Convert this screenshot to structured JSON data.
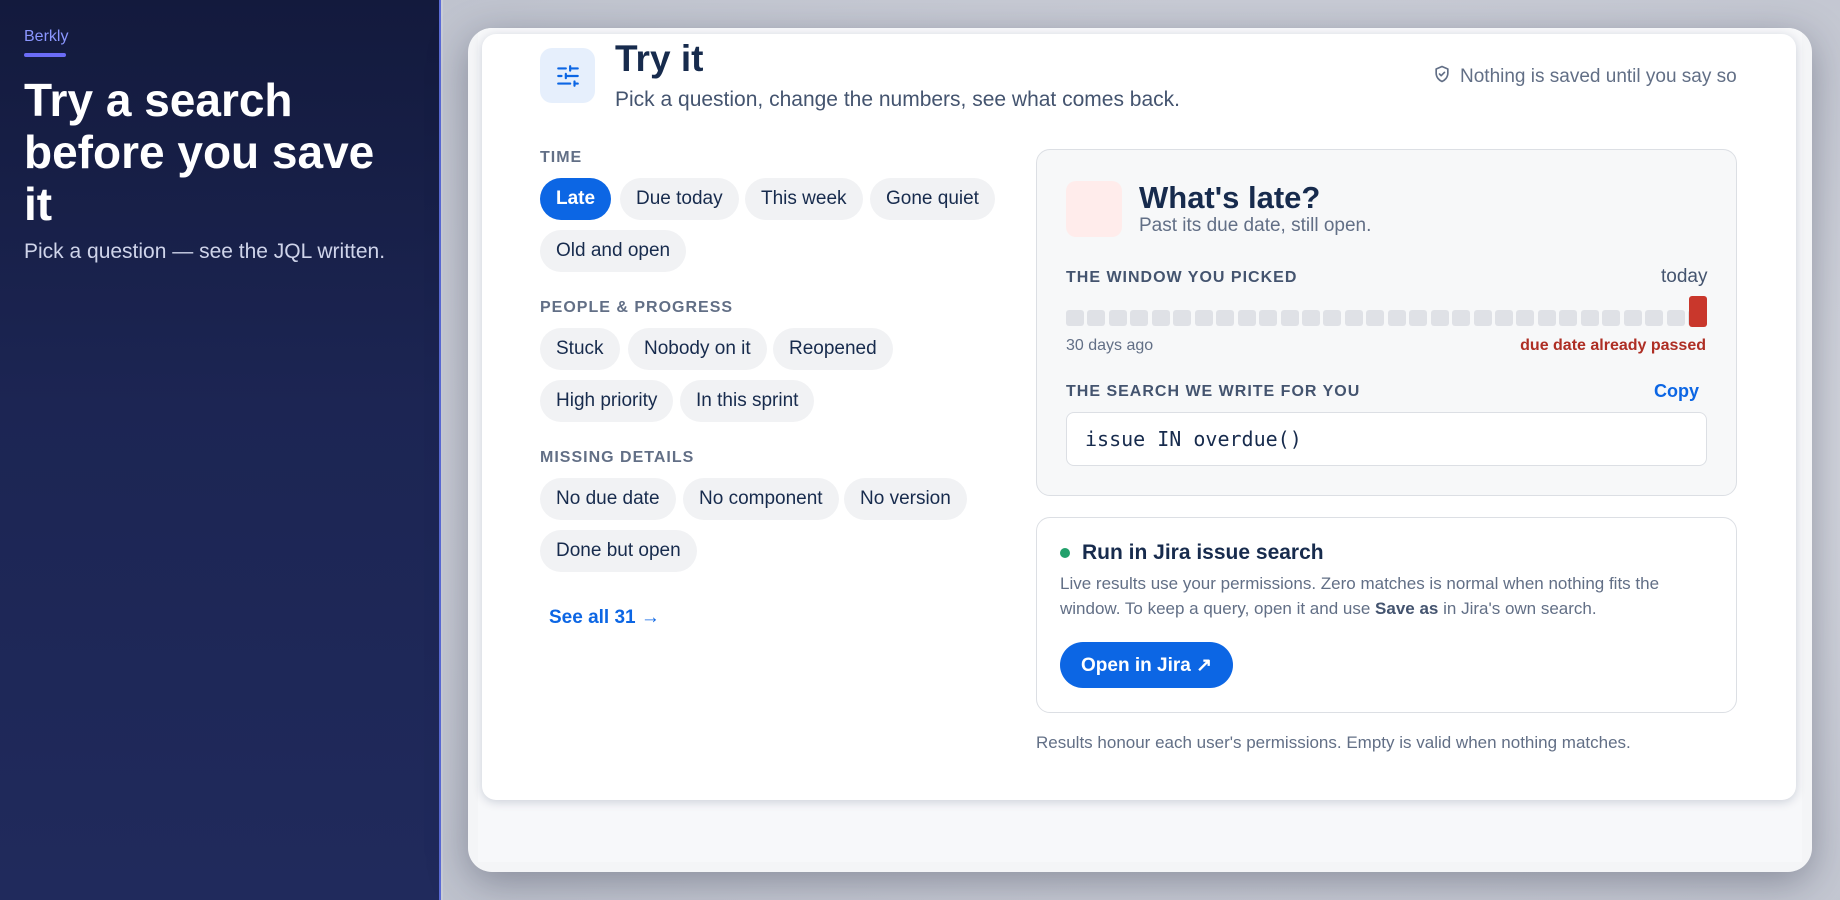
{
  "intro": {
    "brand": "Berkly",
    "headline": "Try a search before you save it",
    "subline": "Pick a question — see the JQL written."
  },
  "header": {
    "icon": "sliders-icon",
    "title": "Try it",
    "subtitle": "Pick a question, change the numbers, see what comes back.",
    "note": "Nothing is saved until you say so",
    "note_icon": "shield-check-icon"
  },
  "filters": {
    "groups": [
      {
        "label": "TIME",
        "chips": [
          "Late",
          "Due today",
          "This week",
          "Gone quiet",
          "Old and open"
        ]
      },
      {
        "label": "PEOPLE & PROGRESS",
        "chips": [
          "Stuck",
          "Nobody on it",
          "Reopened",
          "High priority",
          "In this sprint"
        ]
      },
      {
        "label": "MISSING DETAILS",
        "chips": [
          "No due date",
          "No component",
          "No version",
          "Done but open"
        ]
      }
    ],
    "selected": "Late",
    "see_all": "See all 31 →"
  },
  "result": {
    "title": "What's late?",
    "subtitle": "Past its due date, still open.",
    "window_label": "THE WINDOW YOU PICKED",
    "window_end": "today",
    "window_start_label": "30 days ago",
    "window_status": "due date already passed",
    "query_label": "THE SEARCH WE WRITE FOR YOU",
    "copy_label": "Copy",
    "query": "issue IN overdue()"
  },
  "run": {
    "title": "Run in Jira issue search",
    "text_before": "Live results use your permissions. Zero matches is normal when nothing fits the window. To keep a query, open it and use",
    "text_bold": "Save as",
    "text_after": "in Jira's own search.",
    "button": "Open in Jira ↗"
  },
  "footnote": "Results honour each user's permissions. Empty is valid when nothing matches.",
  "colors": {
    "accent": "#0c66e4",
    "danger": "#c9372c",
    "success": "#22a06b",
    "intro_bg": "#1c2553"
  }
}
